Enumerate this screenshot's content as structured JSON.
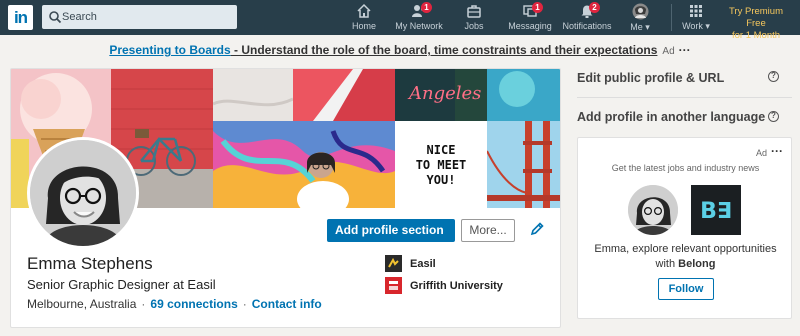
{
  "nav": {
    "logo_text": "in",
    "search_placeholder": "Search",
    "items": [
      {
        "label": "Home",
        "badge": ""
      },
      {
        "label": "My Network",
        "badge": "1"
      },
      {
        "label": "Jobs",
        "badge": ""
      },
      {
        "label": "Messaging",
        "badge": "1"
      },
      {
        "label": "Notifications",
        "badge": "2"
      },
      {
        "label": "Me ▾",
        "badge": ""
      },
      {
        "label": "Work ▾",
        "badge": ""
      }
    ],
    "premium_line1": "Try Premium Free",
    "premium_line2": "for 1 Month"
  },
  "top_ad": {
    "link": "Presenting to Boards",
    "text": " - Understand the role of the board, time constraints and their expectations",
    "ad_label": "Ad",
    "dots": "···"
  },
  "profile": {
    "banner_text_neon": "Angeles",
    "banner_text_card_1": "NICE",
    "banner_text_card_2": "TO MEET",
    "banner_text_card_3": "YOU!",
    "add_section_label": "Add profile section",
    "more_label": "More...",
    "name": "Emma Stephens",
    "headline": "Senior Graphic Designer at Easil",
    "location": "Melbourne, Australia",
    "connections": "69 connections",
    "contact": "Contact info",
    "separator": "·",
    "experience": [
      {
        "name": "Easil"
      },
      {
        "name": "Griffith University"
      }
    ]
  },
  "rail": {
    "edit_profile": "Edit public profile & URL",
    "add_language": "Add profile in another language",
    "help_glyph": "?",
    "ad": {
      "label": "Ad",
      "dots": "···",
      "tagline": "Get the latest jobs and industry news",
      "message_1": "Emma, explore relevant opportunities",
      "message_2_prefix": "with ",
      "message_2_company": "Belong",
      "company_logo_text": "B∃",
      "follow_label": "Follow"
    }
  },
  "colors": {
    "nav_bg": "#283e4a",
    "brand_blue": "#0073b1",
    "badge_red": "#e0253f",
    "premium_gold": "#f5c75d"
  }
}
